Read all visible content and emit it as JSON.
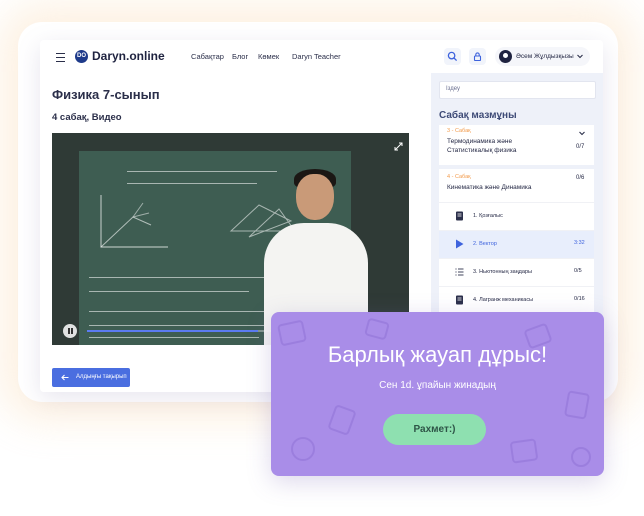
{
  "header": {
    "logo_text": "Daryn.online",
    "logo_mark": "DO",
    "nav": [
      "Сабақтар",
      "Блог",
      "Көмек",
      "Daryn Teacher"
    ],
    "user_name": "Әсем Жұлдызқызы",
    "icons": [
      "menu-icon",
      "search-icon",
      "lock-icon",
      "chevron-down-icon"
    ]
  },
  "main": {
    "title": "Физика 7-сынып",
    "subtitle": "4 сабақ, Видео",
    "video_progress": 0.55,
    "back_button": "Алдыңғы тақырып"
  },
  "sidebar": {
    "search_text": "Іздеу",
    "title": "Сабақ мазмұны",
    "sections": [
      {
        "overline": "3 - Сабақ",
        "name_line1": "Термодинамика және",
        "name_line2": "Статистикалық физика",
        "count": "0/7"
      },
      {
        "overline": "4 - Сабақ",
        "name_line1": "Кинематика және Динамика",
        "count": "0/6"
      }
    ],
    "lessons": [
      {
        "name": "1. Қозғалыс",
        "count": "",
        "icon": "document-icon"
      },
      {
        "name": "2. Вектор",
        "count": "3:32",
        "icon": "play-icon",
        "active": true
      },
      {
        "name": "3. Ньютонның заңдары",
        "count": "0/5",
        "icon": "list-icon"
      },
      {
        "name": "4. Лагранж механикасы",
        "count": "0/16",
        "icon": "document-icon"
      }
    ]
  },
  "modal": {
    "title": "Барлық жауап дұрыс!",
    "text": "Сен 1d. ұпайын жинадың",
    "button": "Рахмет:)"
  },
  "colors": {
    "accent": "#4a6ee0",
    "modal_bg": "#a98de8",
    "button_green": "#8ee0b0",
    "section_overline": "#f29a4a"
  }
}
